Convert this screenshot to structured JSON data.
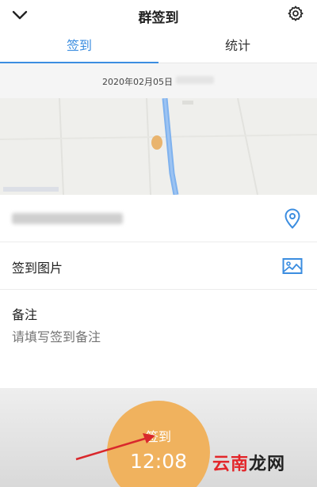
{
  "header": {
    "title": "群签到",
    "back_icon": "chevron-down-icon",
    "settings_icon": "gear-icon"
  },
  "tabs": [
    {
      "label": "签到",
      "active": true
    },
    {
      "label": "统计",
      "active": false
    }
  ],
  "date": "2020年02月05日",
  "location_row": {
    "icon": "location-pin-icon"
  },
  "photo_row": {
    "label": "签到图片",
    "icon": "image-icon"
  },
  "remark": {
    "label": "备注",
    "placeholder": "请填写签到备注"
  },
  "checkin_button": {
    "label": "签到",
    "time": "12:08"
  },
  "watermark": {
    "part1": "云南",
    "part2": "龙网"
  },
  "colors": {
    "accent_blue": "#3b8de0",
    "button_orange": "#f0b25e",
    "arrow_red": "#d9282c"
  }
}
